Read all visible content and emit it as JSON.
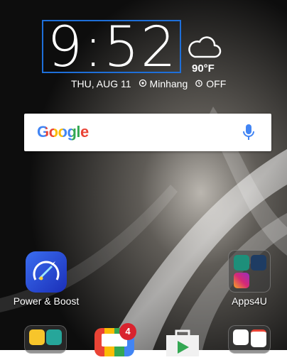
{
  "clock": {
    "time": "9:52",
    "date": "THU, AUG 11",
    "location": "Minhang",
    "alarm": "OFF"
  },
  "weather": {
    "temperature": "90°F",
    "icon": "cloud-icon"
  },
  "search": {
    "logo": "Google",
    "icon": "mic-icon"
  },
  "apps": [
    {
      "label": "Power & Boost",
      "icon": "rocket-speedometer-icon"
    },
    {
      "label": "Apps4U",
      "icon": "folder-icon"
    }
  ],
  "dock": {
    "badge_count": "4"
  },
  "colors": {
    "accent": "#1e6fd9",
    "badge": "#d9232e",
    "google_blue": "#4285F4",
    "google_red": "#EA4335",
    "google_yellow": "#FBBC05",
    "google_green": "#34A853"
  }
}
